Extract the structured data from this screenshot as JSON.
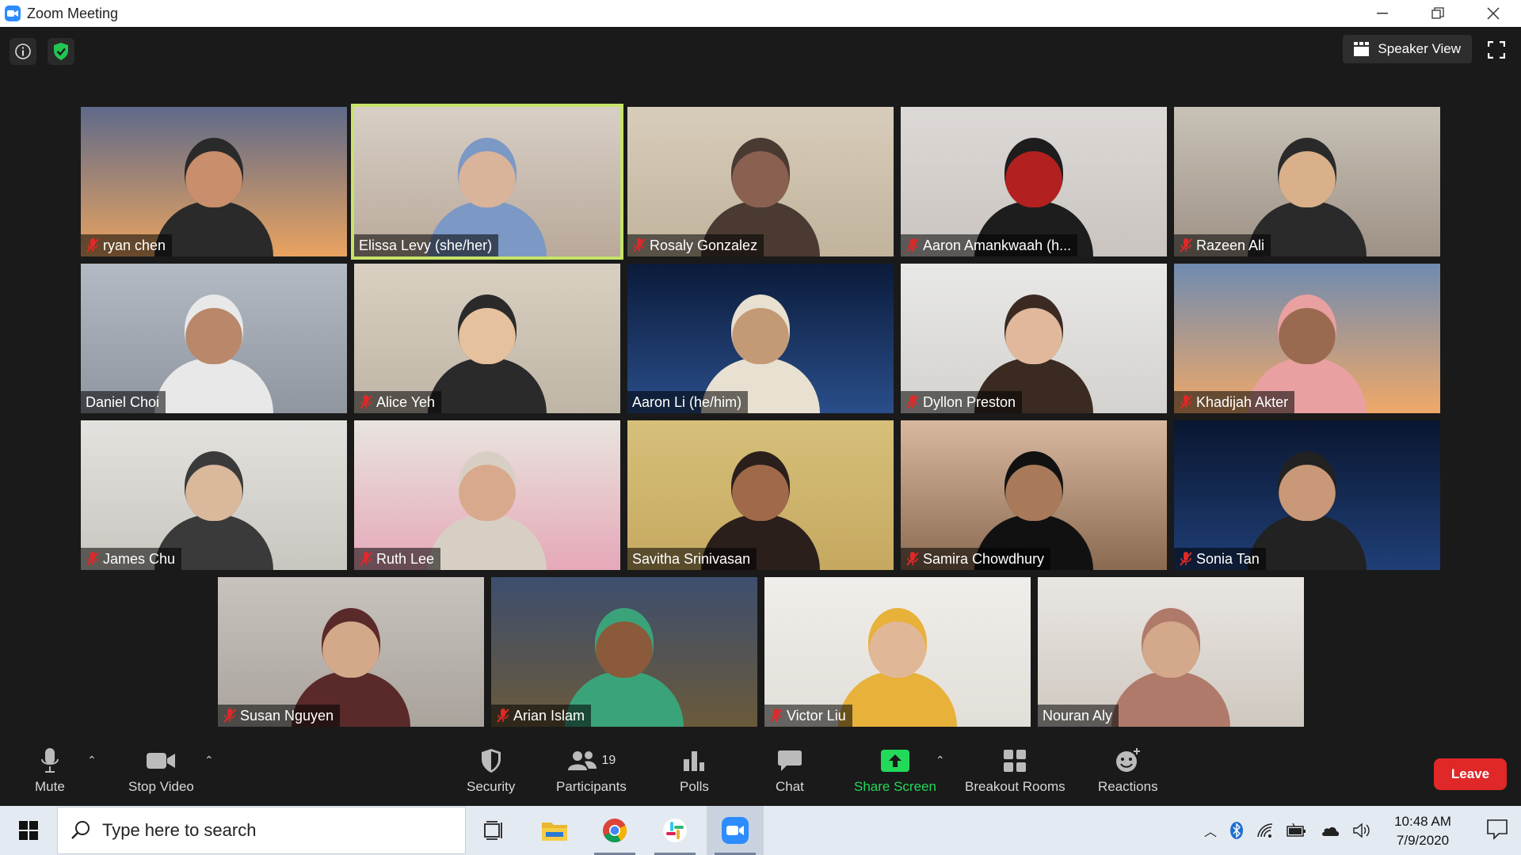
{
  "window": {
    "title": "Zoom Meeting"
  },
  "header": {
    "speaker_view_label": "Speaker View"
  },
  "participants": [
    {
      "name": "ryan chen",
      "muted": true,
      "active": false
    },
    {
      "name": "Elissa Levy (she/her)",
      "muted": false,
      "active": true
    },
    {
      "name": "Rosaly Gonzalez",
      "muted": true,
      "active": false
    },
    {
      "name": "Aaron Amankwaah (h...",
      "muted": true,
      "active": false
    },
    {
      "name": "Razeen Ali",
      "muted": true,
      "active": false
    },
    {
      "name": "Daniel Choi",
      "muted": false,
      "active": false
    },
    {
      "name": "Alice Yeh",
      "muted": true,
      "active": false
    },
    {
      "name": "Aaron Li (he/him)",
      "muted": false,
      "active": false
    },
    {
      "name": "Dyllon Preston",
      "muted": true,
      "active": false
    },
    {
      "name": "Khadijah Akter",
      "muted": true,
      "active": false
    },
    {
      "name": "James Chu",
      "muted": true,
      "active": false
    },
    {
      "name": "Ruth Lee",
      "muted": true,
      "active": false
    },
    {
      "name": "Savitha Srinivasan",
      "muted": false,
      "active": false
    },
    {
      "name": "Samira Chowdhury",
      "muted": true,
      "active": false
    },
    {
      "name": "Sonia Tan",
      "muted": true,
      "active": false
    },
    {
      "name": "Susan Nguyen",
      "muted": true,
      "active": false
    },
    {
      "name": "Arian Islam",
      "muted": true,
      "active": false
    },
    {
      "name": "Victor Liu",
      "muted": true,
      "active": false
    },
    {
      "name": "Nouran Aly",
      "muted": false,
      "active": false
    }
  ],
  "toolbar": {
    "mute": "Mute",
    "stop_video": "Stop Video",
    "security": "Security",
    "participants": "Participants",
    "participants_count": "19",
    "polls": "Polls",
    "chat": "Chat",
    "share_screen": "Share Screen",
    "breakout_rooms": "Breakout Rooms",
    "reactions": "Reactions",
    "leave": "Leave"
  },
  "taskbar": {
    "search_placeholder": "Type here to search",
    "time": "10:48 AM",
    "date": "7/9/2020"
  },
  "colors": {
    "active_speaker_border": "#c7e36a",
    "leave_button": "#e02828",
    "share_screen": "#23d959",
    "mic_off": "#e02828"
  }
}
